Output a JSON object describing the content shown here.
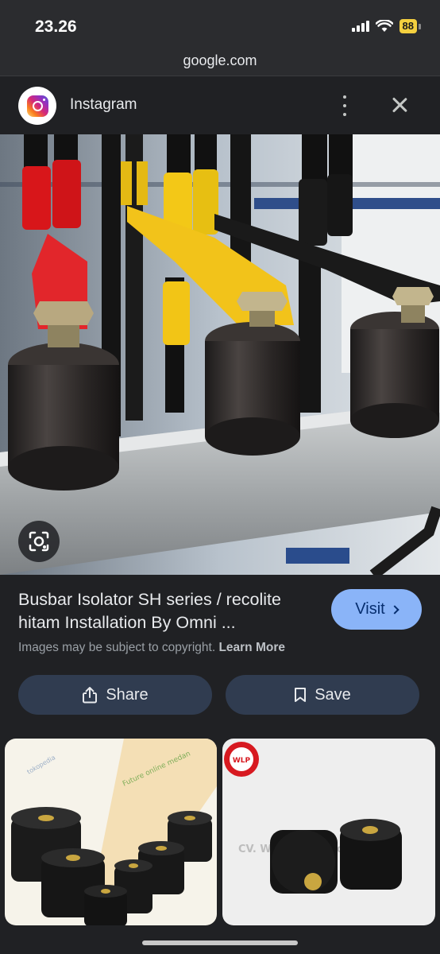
{
  "status_bar": {
    "time": "23.26",
    "battery": "88"
  },
  "url_bar": {
    "domain": "google.com"
  },
  "source": {
    "name": "Instagram"
  },
  "result": {
    "title": "Busbar Isolator SH series / recolite hitam Installation By Omni ...",
    "visit_label": "Visit",
    "copyright_text": "Images may be subject to copyright.",
    "learn_more_label": "Learn More"
  },
  "actions": {
    "share_label": "Share",
    "save_label": "Save"
  },
  "thumbnails": {
    "left_watermark_1": "Future online medan",
    "left_watermark_2": "tokopedia",
    "right_logo": "WLP",
    "right_watermark": "CV. W... ...rtnik Connection"
  },
  "colors": {
    "accent": "#8ab4f8",
    "action_bg": "#303c50",
    "background": "#202124"
  },
  "icons": [
    "signal-icon",
    "wifi-icon",
    "battery-icon",
    "instagram-icon",
    "more-vert-icon",
    "close-icon",
    "lens-icon",
    "chevron-right-icon",
    "share-icon",
    "bookmark-icon"
  ]
}
